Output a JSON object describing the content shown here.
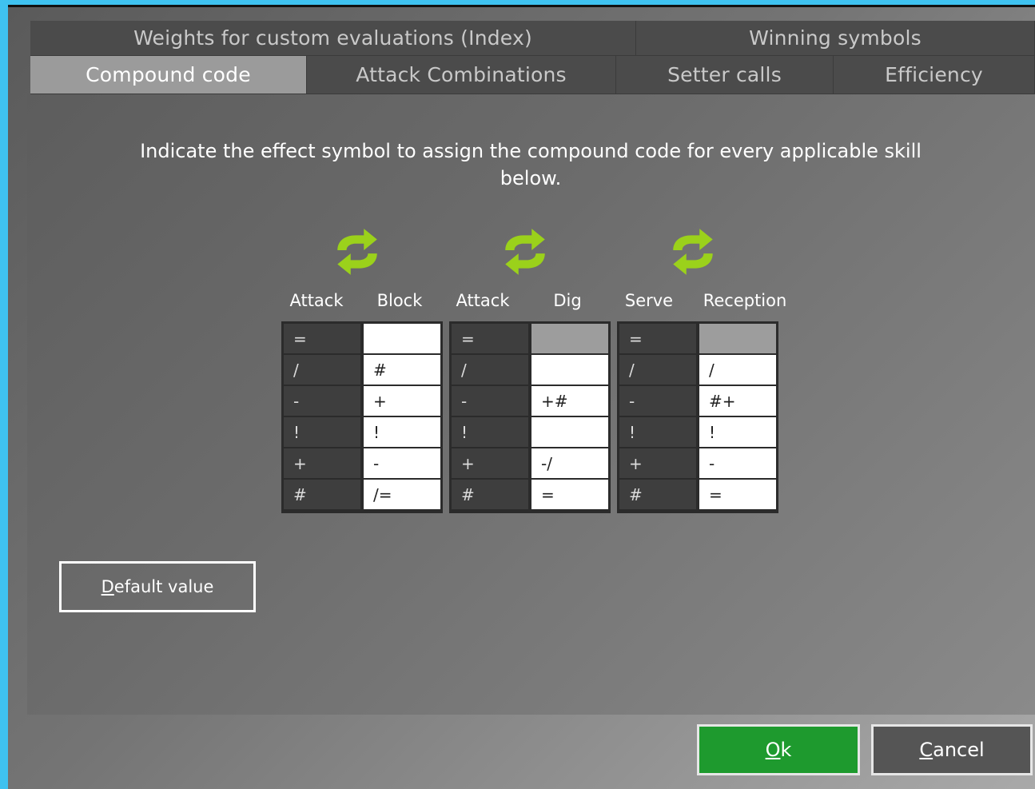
{
  "tabs_row1": [
    {
      "label": "Weights for custom evaluations (Index)"
    },
    {
      "label": "Winning symbols"
    }
  ],
  "tabs_row2": [
    {
      "label": "Compound code",
      "active": true
    },
    {
      "label": "Attack Combinations"
    },
    {
      "label": "Setter calls"
    },
    {
      "label": "Efficiency"
    }
  ],
  "instruction": "Indicate the effect symbol to assign the compound code for every applicable skill below.",
  "groups": [
    {
      "left_label": "Attack",
      "right_label": "Block",
      "rows": [
        {
          "left": "=",
          "right": ""
        },
        {
          "left": "/",
          "right": "#"
        },
        {
          "left": "-",
          "right": "+"
        },
        {
          "left": "!",
          "right": "!"
        },
        {
          "left": "+",
          "right": "-"
        },
        {
          "left": "#",
          "right": "/="
        }
      ]
    },
    {
      "left_label": "Attack",
      "right_label": "Dig",
      "rows": [
        {
          "left": "=",
          "right": "",
          "disabled": true
        },
        {
          "left": "/",
          "right": ""
        },
        {
          "left": "-",
          "right": "+#"
        },
        {
          "left": "!",
          "right": ""
        },
        {
          "left": "+",
          "right": "-/"
        },
        {
          "left": "#",
          "right": "="
        }
      ]
    },
    {
      "left_label": "Serve",
      "right_label": "Reception",
      "rows": [
        {
          "left": "=",
          "right": "",
          "disabled": true
        },
        {
          "left": "/",
          "right": "/"
        },
        {
          "left": "-",
          "right": "#+"
        },
        {
          "left": "!",
          "right": "!"
        },
        {
          "left": "+",
          "right": "-"
        },
        {
          "left": "#",
          "right": "="
        }
      ]
    }
  ],
  "buttons": {
    "default_first": "D",
    "default_rest": "efault value",
    "ok_first": "O",
    "ok_rest": "k",
    "cancel_first": "C",
    "cancel_rest": "ancel"
  },
  "colors": {
    "accent_green": "#1e9a2e",
    "icon_green": "#9bd11b",
    "active_tab": "#9b9b9b"
  },
  "icons": {
    "swap": "swap-arrows-icon"
  }
}
